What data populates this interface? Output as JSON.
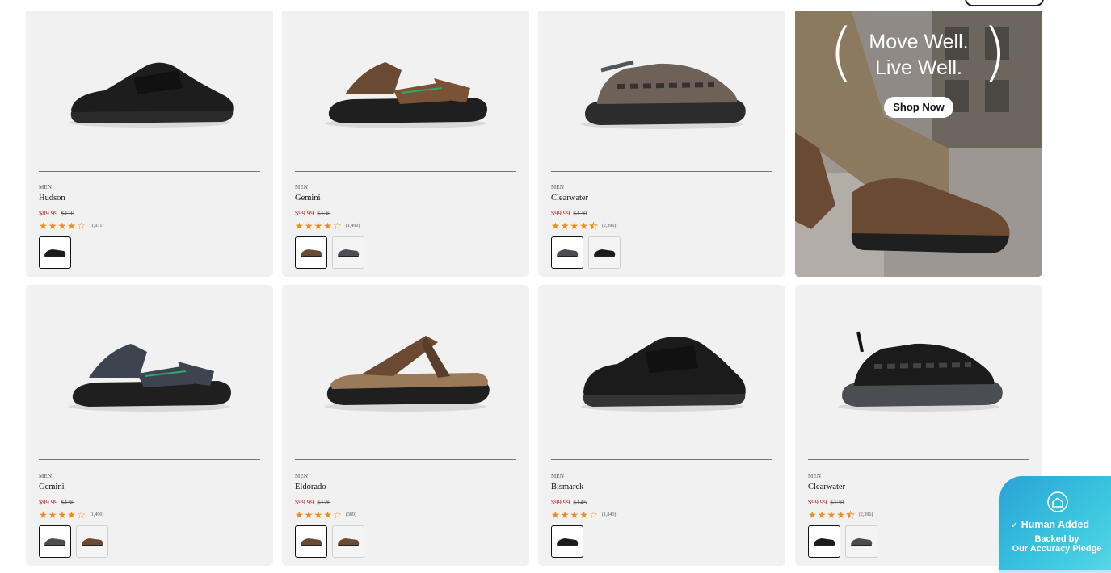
{
  "promo": {
    "headline_line1": "Move Well.",
    "headline_line2": "Live Well.",
    "button": "Shop Now",
    "colors": {
      "overlay_text": "#ffffff",
      "button_bg": "#ffffff"
    }
  },
  "products": [
    {
      "gender": "MEN",
      "name": "Hudson",
      "sale_price": "$89.99",
      "orig_price": "$110",
      "rating": 4,
      "reviews": "(1,931)",
      "swatches": [
        "black"
      ],
      "selected": 0
    },
    {
      "gender": "MEN",
      "name": "Gemini",
      "sale_price": "$99.99",
      "orig_price": "$130",
      "rating": 4,
      "reviews": "(1,490)",
      "swatches": [
        "brown",
        "gray"
      ],
      "selected": 0
    },
    {
      "gender": "MEN",
      "name": "Clearwater",
      "sale_price": "$99.99",
      "orig_price": "$130",
      "rating": 4.5,
      "reviews": "(2,396)",
      "swatches": [
        "gray",
        "black"
      ],
      "selected": 0
    },
    {
      "gender": "MEN",
      "name": "Gemini",
      "sale_price": "$99.99",
      "orig_price": "$130",
      "rating": 4,
      "reviews": "(1,490)",
      "swatches": [
        "gray",
        "brown"
      ],
      "selected": 0
    },
    {
      "gender": "MEN",
      "name": "Eldorado",
      "sale_price": "$99.99",
      "orig_price": "$120",
      "rating": 4,
      "reviews": "(389)",
      "swatches": [
        "brown",
        "brown"
      ],
      "selected": 0
    },
    {
      "gender": "MEN",
      "name": "Bismarck",
      "sale_price": "$99.99",
      "orig_price": "$145",
      "rating": 4,
      "reviews": "(1,843)",
      "swatches": [
        "black"
      ],
      "selected": 0
    },
    {
      "gender": "MEN",
      "name": "Clearwater",
      "sale_price": "$99.99",
      "orig_price": "$130",
      "rating": 4.5,
      "reviews": "(2,396)",
      "swatches": [
        "black",
        "gray"
      ],
      "selected": 0
    }
  ],
  "badge": {
    "title": "Human Added",
    "line1": "Backed by",
    "line2": "Our Accuracy Pledge"
  },
  "colors": {
    "sale": "#c0201a",
    "star": "#f08c1a",
    "card_bg": "#f1f1f1"
  }
}
